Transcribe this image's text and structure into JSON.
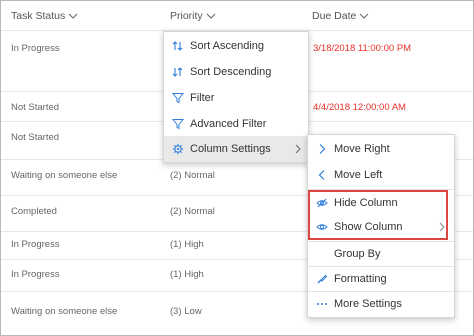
{
  "columns": {
    "task_status": "Task Status",
    "priority": "Priority",
    "due_date": "Due Date"
  },
  "rows": [
    {
      "status": "In Progress",
      "priority": "",
      "due": "3/18/2018 11:00:00 PM"
    },
    {
      "status": "Not Started",
      "priority": "",
      "due": "4/4/2018 12:00:00 AM"
    },
    {
      "status": "Not Started",
      "priority": "",
      "due": ""
    },
    {
      "status": "Waiting on someone else",
      "priority": "(2) Normal",
      "due": ""
    },
    {
      "status": "Completed",
      "priority": "(2) Normal",
      "due": ""
    },
    {
      "status": "In Progress",
      "priority": "(1) High",
      "due": ""
    },
    {
      "status": "In Progress",
      "priority": "(1) High",
      "due": ""
    },
    {
      "status": "Waiting on someone else",
      "priority": "(3) Low",
      "due": ""
    }
  ],
  "column_menu": {
    "items": [
      {
        "label": "Sort Ascending",
        "icon": "sort-ascending-icon"
      },
      {
        "label": "Sort Descending",
        "icon": "sort-descending-icon"
      },
      {
        "label": "Filter",
        "icon": "filter-icon"
      },
      {
        "label": "Advanced Filter",
        "icon": "advanced-filter-icon"
      },
      {
        "label": "Column Settings",
        "icon": "gear-icon"
      }
    ]
  },
  "column_settings_menu": {
    "items": [
      {
        "label": "Move Right",
        "icon": "chevron-right-icon"
      },
      {
        "label": "Move Left",
        "icon": "chevron-left-icon"
      },
      {
        "label": "Hide Column",
        "icon": "eye-hidden-icon"
      },
      {
        "label": "Show Column",
        "icon": "eye-icon"
      },
      {
        "label": "Group By",
        "icon": ""
      },
      {
        "label": "Formatting",
        "icon": "paint-brush-icon"
      },
      {
        "label": "More Settings",
        "icon": "ellipsis-icon"
      }
    ]
  },
  "colors": {
    "accent": "#2f7ed8",
    "due_date_red": "#e8312a",
    "highlight_border": "#d9473f"
  }
}
